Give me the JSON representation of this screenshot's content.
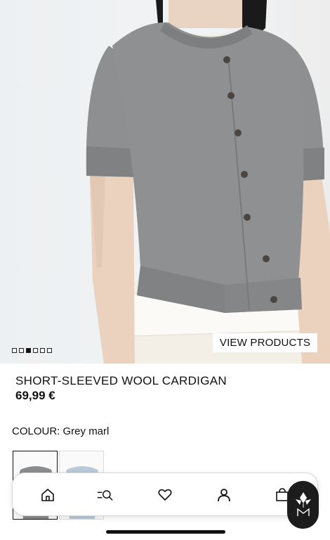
{
  "product": {
    "title": "SHORT-SLEEVED WOOL CARDIGAN",
    "price": "69,99 €",
    "view_products_label": "VIEW PRODUCTS",
    "gallery": {
      "image_count": 6,
      "active_index": 2
    }
  },
  "colour": {
    "label": "COLOUR:",
    "value": "Grey marl",
    "options": [
      {
        "name": "Grey marl",
        "color": "#8a8c8e",
        "selected": true
      },
      {
        "name": "Light blue",
        "color": "#b9c9d8",
        "selected": false
      }
    ]
  },
  "bottom_nav": {
    "items": [
      {
        "name": "home",
        "icon": "home-icon"
      },
      {
        "name": "search",
        "icon": "search-menu-icon"
      },
      {
        "name": "wishlist",
        "icon": "heart-icon"
      },
      {
        "name": "account",
        "icon": "user-icon"
      },
      {
        "name": "bag",
        "icon": "shopping-bag-icon"
      }
    ]
  },
  "colors": {
    "garment": "#8b8d8f",
    "background": "#eef0f1",
    "text": "#111111"
  }
}
